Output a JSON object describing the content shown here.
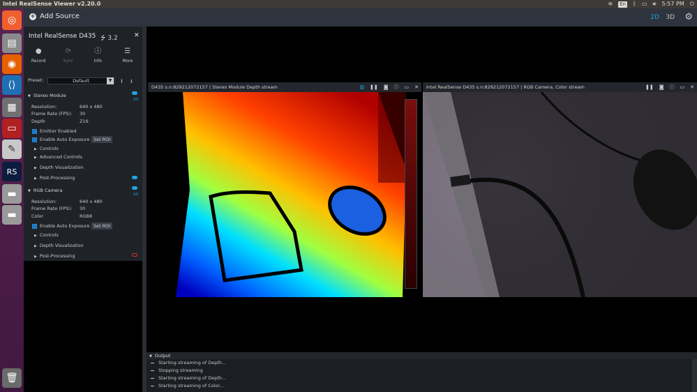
{
  "window": {
    "title": "Intel RealSense Viewer v2.20.0"
  },
  "system_tray": {
    "lang": "En",
    "time": "5:57 PM"
  },
  "sidebar": {
    "add_source_label": "Add Source"
  },
  "toolbar": {
    "view_2d": "2D",
    "view_3d": "3D"
  },
  "device": {
    "name": "Intel RealSense D435",
    "usb": "3.2",
    "buttons": [
      {
        "label": "Record",
        "icon": "record-icon"
      },
      {
        "label": "Sync",
        "icon": "sync-icon"
      },
      {
        "label": "Info",
        "icon": "info-icon"
      },
      {
        "label": "More",
        "icon": "menu-icon"
      }
    ],
    "preset_label": "Preset:",
    "preset_value": "Default"
  },
  "stereo_module": {
    "title": "Stereo Module",
    "toggle": "on",
    "resolution_label": "Resolution:",
    "resolution": "640 x 480",
    "fps_label": "Frame Rate (FPS):",
    "fps": "30",
    "format_label": "Depth",
    "format": "Z16",
    "emitter_label": "Emitter Enabled",
    "auto_exposure_label": "Enable Auto Exposure",
    "set_roi_label": "Set ROI",
    "sections": [
      "Controls",
      "Advanced Controls",
      "Depth Visualization",
      "Post-Processing"
    ]
  },
  "rgb_camera": {
    "title": "RGB Camera",
    "toggle": "on",
    "resolution_label": "Resolution:",
    "resolution": "640 x 480",
    "fps_label": "Frame Rate (FPS):",
    "fps": "30",
    "format_label": "Color",
    "format": "RGB8",
    "auto_exposure_label": "Enable Auto Exposure",
    "set_roi_label": "Set ROI",
    "sections": [
      "Controls",
      "Depth Visualization",
      "Post-Processing"
    ]
  },
  "streams": {
    "depth": {
      "title": "D435 s.n:829212072157 | Stereo Module Depth stream",
      "scale": [
        "4",
        "3",
        "2",
        "1",
        "0"
      ]
    },
    "color": {
      "title": "Intel RealSense D435 s.n:829212072157 | RGB Camera, Color stream"
    }
  },
  "output": {
    "header": "Output",
    "lines": [
      "Starting streaming of Depth...",
      "Stopping streaming",
      "Starting streaming of Depth...",
      "Starting streaming of Color..."
    ]
  }
}
